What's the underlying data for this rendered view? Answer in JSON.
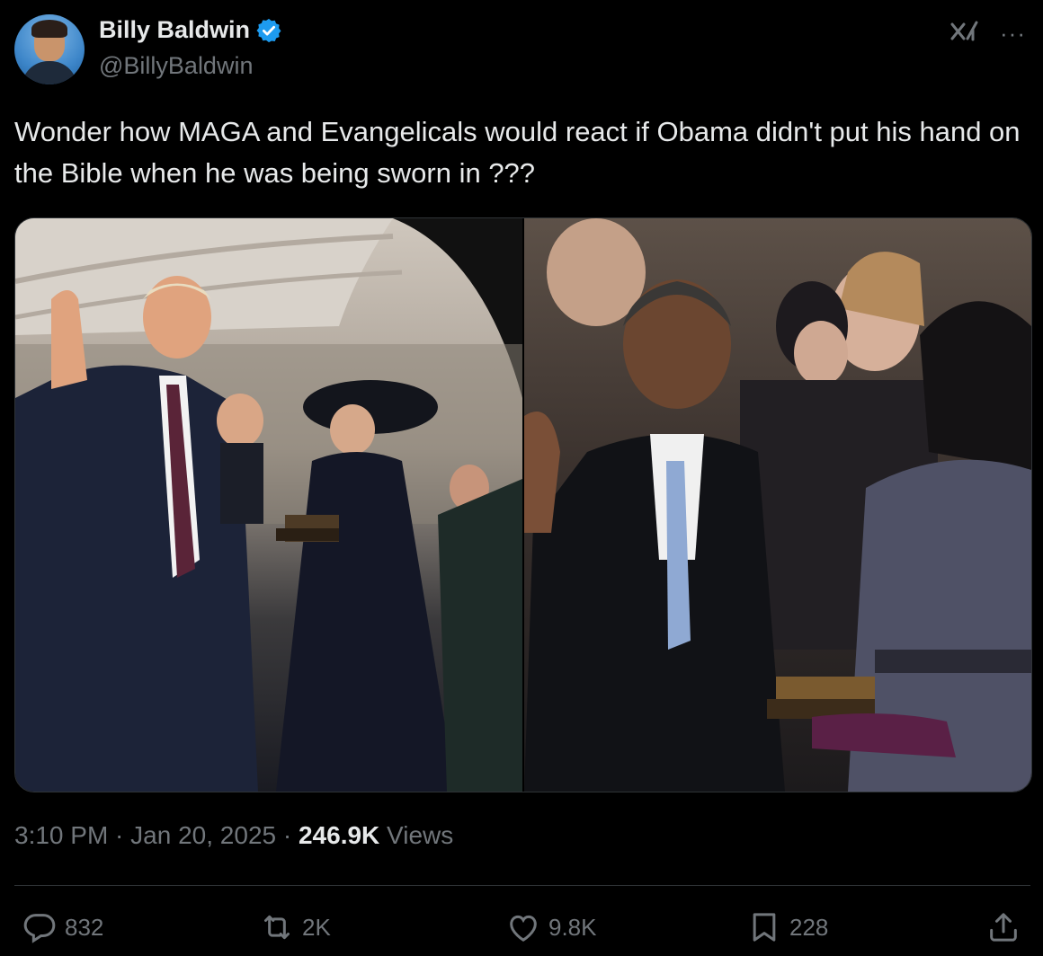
{
  "author": {
    "name": "Billy Baldwin",
    "handle": "@BillyBaldwin",
    "verified": true
  },
  "tweet": {
    "text": "Wonder how MAGA and Evangelicals would react if Obama didn't put his hand on the Bible when he was being sworn in ???"
  },
  "meta": {
    "time": "3:10 PM",
    "sep1": " · ",
    "date": "Jan 20, 2025",
    "sep2": " · ",
    "views_count": "246.9K",
    "views_label": " Views"
  },
  "actions": {
    "replies": "832",
    "reposts": "2K",
    "likes": "9.8K",
    "bookmarks": "228"
  },
  "icons": {
    "verified": "verified-badge-icon",
    "grok": "grok-icon",
    "more": "more-icon",
    "reply": "reply-icon",
    "repost": "repost-icon",
    "like": "like-icon",
    "bookmark": "bookmark-icon",
    "share": "share-icon"
  },
  "colors": {
    "background": "#000000",
    "text": "#e7e9ea",
    "muted": "#71767b",
    "verified": "#1d9bf0",
    "divider": "#2f3336"
  }
}
